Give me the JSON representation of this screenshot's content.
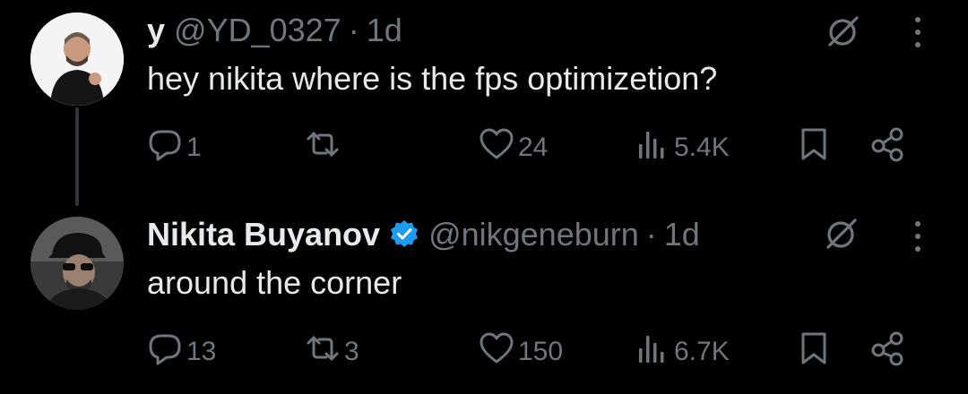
{
  "tweets": [
    {
      "author_name": "y",
      "handle": "@YD_0327",
      "separator": "·",
      "time": "1d",
      "verified": false,
      "text": "hey nikita where is the fps optimizetion?",
      "replies": "1",
      "retweets": "",
      "likes": "24",
      "views": "5.4K"
    },
    {
      "author_name": "Nikita Buyanov",
      "handle": "@nikgeneburn",
      "separator": "·",
      "time": "1d",
      "verified": true,
      "text": "around the corner",
      "replies": "13",
      "retweets": "3",
      "likes": "150",
      "views": "6.7K"
    }
  ],
  "icons": {
    "grok": "grok-icon",
    "more": "more-vertical-icon",
    "reply": "reply-icon",
    "retweet": "retweet-icon",
    "like": "heart-icon",
    "views": "views-icon",
    "bookmark": "bookmark-icon",
    "share": "share-icon",
    "verified": "verified-badge-icon"
  },
  "colors": {
    "background": "#000000",
    "text": "#e7e9ea",
    "secondary": "#71767b",
    "verified": "#1d9bf0",
    "thread_line": "#333639"
  }
}
